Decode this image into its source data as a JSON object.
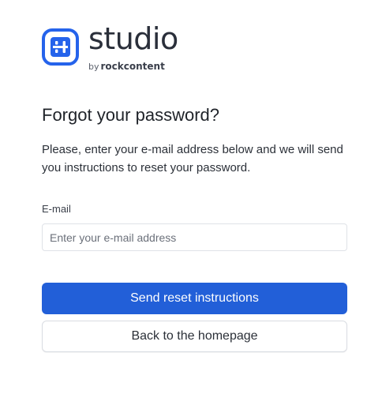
{
  "brand": {
    "name": "studio",
    "tagline_by": "by",
    "tagline_company": "rockcontent",
    "accent_color": "#2563eb"
  },
  "page": {
    "title": "Forgot your password?",
    "description": "Please, enter your e-mail address below and we will send you instructions to reset your password."
  },
  "form": {
    "email_label": "E-mail",
    "email_placeholder": "Enter your e-mail address",
    "email_value": ""
  },
  "actions": {
    "primary_label": "Send reset instructions",
    "primary_color": "#225fd8",
    "secondary_label": "Back to the homepage"
  }
}
